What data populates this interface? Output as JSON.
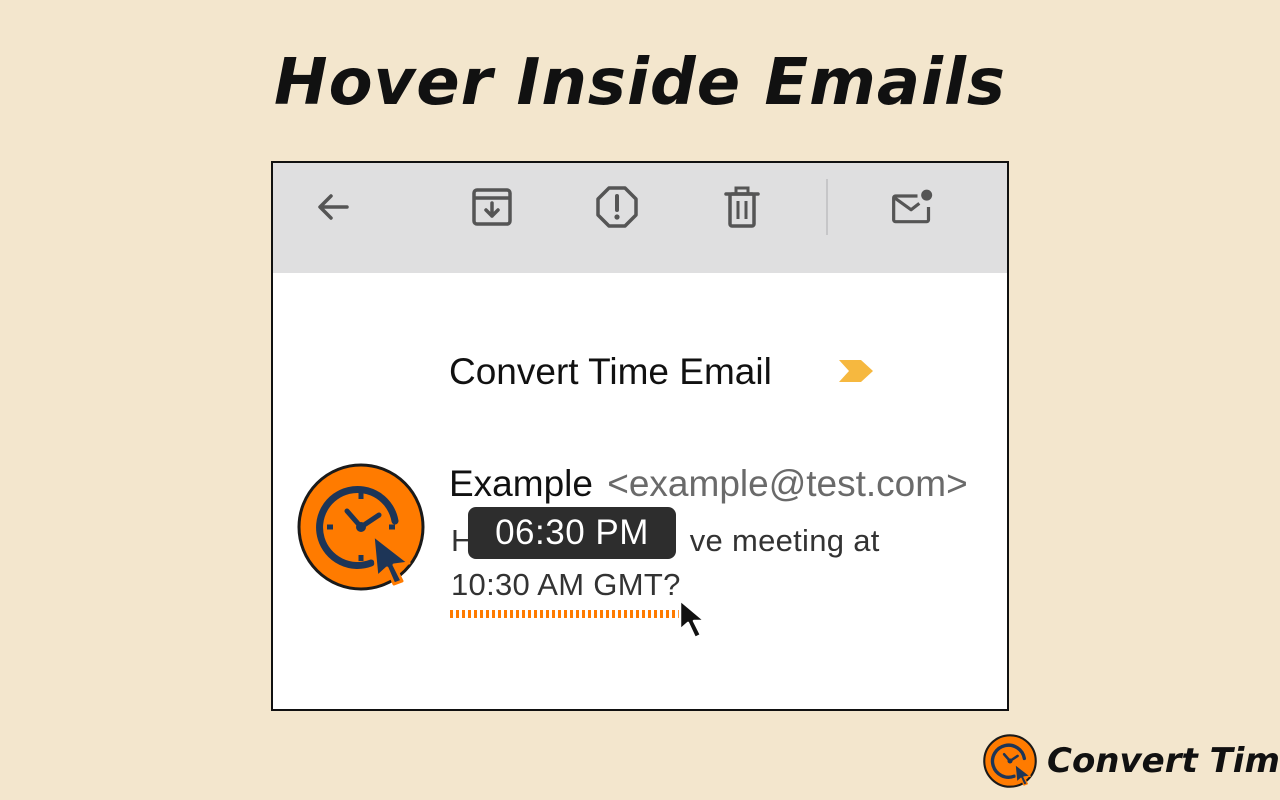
{
  "headline": "Hover Inside Emails",
  "toolbar": {
    "icons": [
      "back-arrow-icon",
      "archive-icon",
      "report-spam-icon",
      "delete-icon",
      "mark-unread-icon"
    ]
  },
  "email": {
    "subject": "Convert Time Email",
    "sender_name": "Example",
    "sender_email": "<example@test.com>",
    "body_line_1_start": "H",
    "body_line_1_end": "ve meeting at",
    "body_line_2": "10:30 AM GMT?"
  },
  "tooltip": {
    "converted_time": "06:30 PM"
  },
  "brand": {
    "name": "Convert Time"
  },
  "colors": {
    "background": "#f3e6cd",
    "accent_orange": "#ff7b00",
    "label_yellow": "#f6b83f",
    "navy": "#1d3557",
    "toolbar_gray": "#dfdfe0",
    "tooltip_bg": "#2d2d2d"
  }
}
